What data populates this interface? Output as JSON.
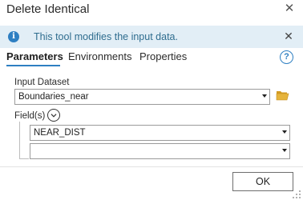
{
  "window": {
    "title": "Delete Identical",
    "close_symbol": "✕"
  },
  "banner": {
    "icon": "info-icon",
    "icon_glyph": "i",
    "message": "This tool modifies the input data.",
    "close_symbol": "✕"
  },
  "tabs": [
    {
      "label": "Parameters",
      "active": true
    },
    {
      "label": "Environments",
      "active": false
    },
    {
      "label": "Properties",
      "active": false
    }
  ],
  "help": {
    "icon": "help-icon",
    "glyph": "?"
  },
  "input_dataset": {
    "label": "Input Dataset",
    "value": "Boundaries_near",
    "browse_icon": "folder-icon"
  },
  "fields": {
    "label": "Field(s)",
    "expand_icon": "chevron-down-circle-icon",
    "rows": [
      {
        "value": "NEAR_DIST"
      },
      {
        "value": ""
      }
    ]
  },
  "footer": {
    "ok_label": "OK"
  },
  "colors": {
    "accent": "#2e7fc2",
    "banner_bg": "#e2eef6",
    "banner_text": "#2f6d8f",
    "folder": "#e6b43c"
  }
}
